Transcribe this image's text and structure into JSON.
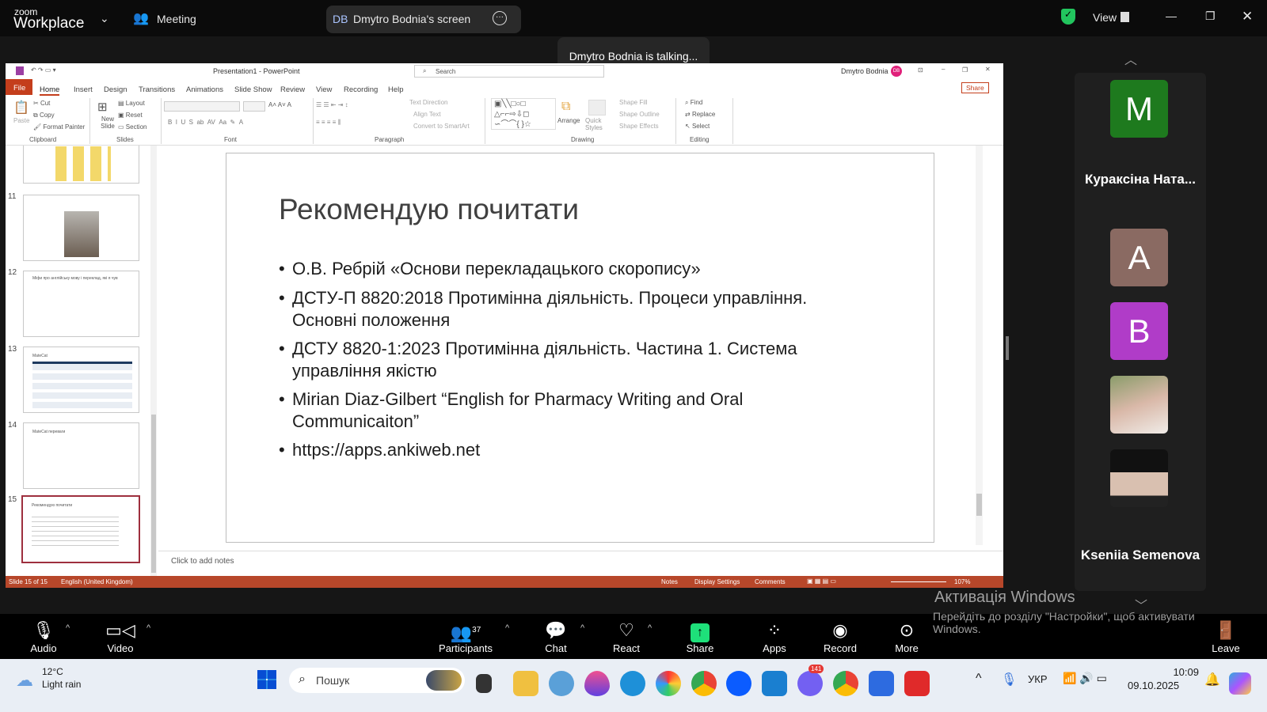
{
  "zoom": {
    "logo_small": "zoom",
    "logo_big": "Workplace",
    "meeting_label": "Meeting",
    "share_initials": "DB",
    "share_label": "Dmytro Bodnia's screen",
    "talking": "Dmytro Bodnia is talking...",
    "view_label": "View"
  },
  "ppt": {
    "title": "Presentation1  -  PowerPoint",
    "search_placeholder": "Search",
    "user": "Dmytro Bodnia",
    "user_initials": "DB",
    "share": "Share",
    "tabs": [
      "File",
      "Home",
      "Insert",
      "Design",
      "Transitions",
      "Animations",
      "Slide Show",
      "Review",
      "View",
      "Recording",
      "Help"
    ],
    "ribbon": {
      "paste": "Paste",
      "cut": "Cut",
      "copy": "Copy",
      "format_painter": "Format Painter",
      "new_slide": "New Slide",
      "layout": "Layout",
      "reset": "Reset",
      "section": "Section",
      "text_direction": "Text Direction",
      "align_text": "Align Text",
      "convert_smartart": "Convert to SmartArt",
      "arrange": "Arrange",
      "quick_styles": "Quick Styles",
      "shape_fill": "Shape Fill",
      "shape_outline": "Shape Outline",
      "shape_effects": "Shape Effects",
      "find": "Find",
      "replace": "Replace",
      "select": "Select",
      "groups": [
        "Clipboard",
        "Slides",
        "Font",
        "Paragraph",
        "Drawing",
        "Editing"
      ]
    },
    "thumbnails": [
      {
        "num": "11",
        "text": ""
      },
      {
        "num": "12",
        "text": "Міфи про англійську мову і переклад, які я чув"
      },
      {
        "num": "13",
        "text": "MateCat"
      },
      {
        "num": "14",
        "text": "MateCat переваги"
      },
      {
        "num": "15",
        "text": "Рекомендую почитати"
      }
    ],
    "slide": {
      "title": "Рекомендую почитати",
      "bullets": [
        "О.В. Ребрій «Основи перекладацького скоропису»",
        "ДСТУ-П 8820:2018 Протимінна діяльність. Процеси управління. Основні положення",
        "ДСТУ 8820-1:2023 Протимінна діяльність. Частина 1. Система управління якістю",
        "Mirian Diaz-Gilbert “English for Pharmacy Writing and Oral Communicaiton”",
        "https://apps.ankiweb.net"
      ]
    },
    "notes_placeholder": "Click to add notes",
    "status": {
      "slide": "Slide 15 of 15",
      "language": "English (United Kingdom)",
      "notes": "Notes",
      "display": "Display Settings",
      "comments": "Comments",
      "zoom": "107%"
    }
  },
  "participants": [
    {
      "initial": "M",
      "name": "Кураксіна Ната...",
      "color": "#1e7a1e"
    },
    {
      "initial": "A",
      "name": "",
      "color": "#8a6a62"
    },
    {
      "initial": "B",
      "name": "",
      "color": "#b03cc8"
    },
    {
      "initial": "",
      "name": "",
      "color": "#c9b1a3"
    },
    {
      "initial": "",
      "name": "Kseniia Semenova",
      "color": "#2a2a2a"
    }
  ],
  "toolbar": {
    "audio": "Audio",
    "video": "Video",
    "participants": "Participants",
    "participants_count": "37",
    "chat": "Chat",
    "react": "React",
    "share": "Share",
    "apps": "Apps",
    "record": "Record",
    "more": "More",
    "leave": "Leave"
  },
  "watermark": {
    "title": "Активація Windows",
    "line1": "Перейдіть до розділу \"Настройки\", щоб активувати",
    "line2": "Windows."
  },
  "taskbar": {
    "temp": "12°C",
    "weather": "Light rain",
    "search": "Пошук",
    "badge": "141",
    "lang": "УКР",
    "time": "10:09",
    "date": "09.10.2025"
  }
}
